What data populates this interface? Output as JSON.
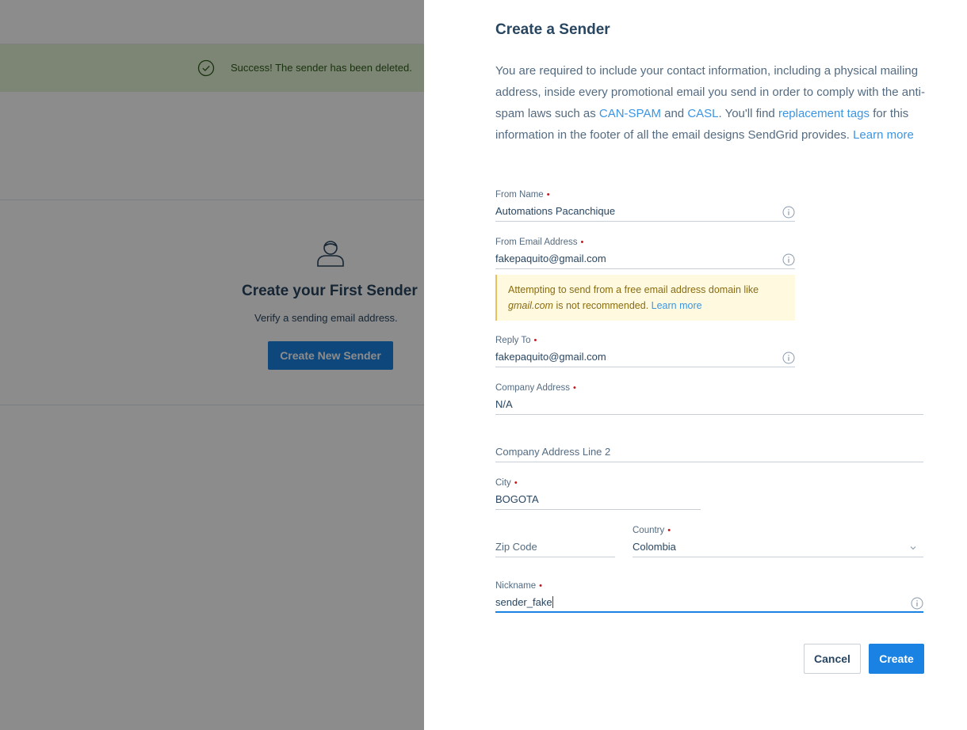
{
  "background": {
    "success_message": "Success! The sender has been deleted.",
    "empty_title": "Create your First Sender",
    "empty_subtitle": "Verify a sending email address.",
    "create_new_button": "Create New Sender"
  },
  "panel": {
    "title": "Create a Sender",
    "intro": {
      "part1": "You are required to include your contact information, including a physical mailing address, inside every promotional email you send in order to comply with the anti-spam laws such as ",
      "link_canspam": "CAN-SPAM",
      "and": " and ",
      "link_casl": "CASL",
      "part2": ". You'll find ",
      "link_tags": "replacement tags",
      "part3": " for this information in the footer of all the email designs SendGrid provides. ",
      "link_learn": "Learn more"
    },
    "fields": {
      "from_name": {
        "label": "From Name",
        "value": "Automations Pacanchique"
      },
      "from_email": {
        "label": "From Email Address",
        "value": "fakepaquito@gmail.com"
      },
      "reply_to": {
        "label": "Reply To",
        "value": "fakepaquito@gmail.com"
      },
      "company_address": {
        "label": "Company Address",
        "value": "N/A"
      },
      "company_address_2": {
        "placeholder": "Company Address Line 2"
      },
      "city": {
        "label": "City",
        "value": "BOGOTA"
      },
      "zip": {
        "placeholder": "Zip Code"
      },
      "country": {
        "label": "Country",
        "value": "Colombia"
      },
      "nickname": {
        "label": "Nickname",
        "value": "sender_fake"
      }
    },
    "warning": {
      "part1": "Attempting to send from a free email address domain like ",
      "domain": "gmail.com",
      "part2": " is not recommended. ",
      "link": "Learn more"
    },
    "required_marker": "•",
    "buttons": {
      "cancel": "Cancel",
      "create": "Create"
    }
  },
  "colors": {
    "primary": "#1a82e2",
    "link": "#3b95e2",
    "required": "#c0161c",
    "success_bg": "#e4f2d6",
    "warning_bg": "#fff9e0"
  }
}
